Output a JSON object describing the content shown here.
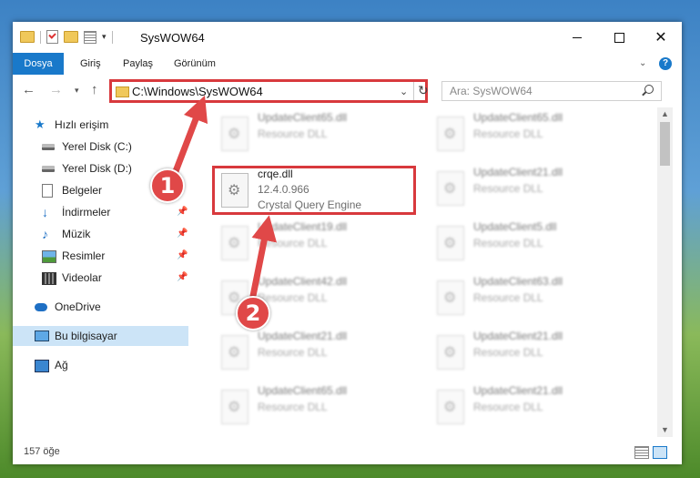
{
  "window": {
    "title": "SysWOW64"
  },
  "ribbon": {
    "tabs": [
      "Dosya",
      "Giriş",
      "Paylaş",
      "Görünüm"
    ],
    "help_label": "?"
  },
  "nav": {
    "back_icon": "back-arrow-icon",
    "forward_icon": "forward-arrow-icon",
    "up_icon": "up-arrow-icon",
    "address": "C:\\Windows\\SysWOW64",
    "search_placeholder": "Ara: SysWOW64"
  },
  "sidebar": {
    "items": [
      {
        "label": "Hızlı erişim",
        "icon": "star-icon"
      },
      {
        "label": "Yerel Disk (C:)",
        "icon": "drive-icon"
      },
      {
        "label": "Yerel Disk (D:)",
        "icon": "drive-icon"
      },
      {
        "label": "Belgeler",
        "icon": "documents-icon"
      },
      {
        "label": "İndirmeler",
        "icon": "downloads-icon"
      },
      {
        "label": "Müzik",
        "icon": "music-icon"
      },
      {
        "label": "Resimler",
        "icon": "pictures-icon"
      },
      {
        "label": "Videolar",
        "icon": "videos-icon"
      },
      {
        "label": "OneDrive",
        "icon": "cloud-icon"
      },
      {
        "label": "Bu bilgisayar",
        "icon": "computer-icon",
        "selected": true
      },
      {
        "label": "Ağ",
        "icon": "network-icon"
      }
    ]
  },
  "files": {
    "highlighted": {
      "name": "crqe.dll",
      "version": "12.4.0.966",
      "description": "Crystal Query Engine"
    },
    "left_column": [
      {
        "name": "UpdateClient65.dll",
        "type": "Resource DLL"
      },
      {
        "name": "UpdateClient19.dll",
        "type": "Resource DLL"
      },
      {
        "name": "UpdateClient42.dll",
        "type": "Resource DLL"
      },
      {
        "name": "UpdateClient21.dll",
        "type": "Resource DLL"
      },
      {
        "name": "UpdateClient65.dll",
        "type": "Resource DLL"
      }
    ],
    "right_column": [
      {
        "name": "UpdateClient65.dll",
        "type": "Resource DLL"
      },
      {
        "name": "UpdateClient21.dll",
        "type": "Resource DLL"
      },
      {
        "name": "UpdateClient5.dll",
        "type": "Resource DLL"
      },
      {
        "name": "UpdateClient63.dll",
        "type": "Resource DLL"
      },
      {
        "name": "UpdateClient21.dll",
        "type": "Resource DLL"
      },
      {
        "name": "UpdateClient21.dll",
        "type": "Resource DLL"
      }
    ]
  },
  "status": {
    "item_count": "157 öğe"
  },
  "annotations": {
    "step1": "1",
    "step2": "2",
    "color": "#e04848"
  },
  "colors": {
    "accent": "#1979ca",
    "highlight_border": "#d8393d"
  }
}
